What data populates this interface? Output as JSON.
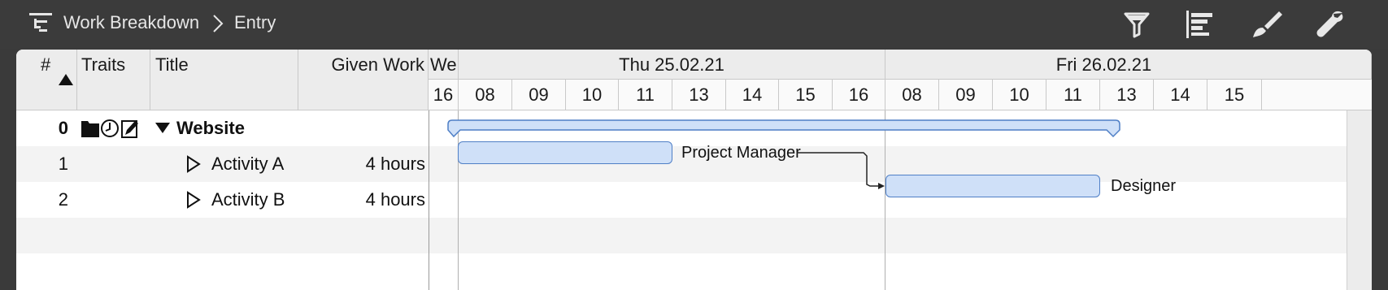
{
  "toolbar": {
    "breadcrumb_root": "Work Breakdown",
    "breadcrumb_current": "Entry",
    "icons": [
      "filter-icon",
      "gantt-icon",
      "brush-icon",
      "wrench-icon"
    ]
  },
  "table": {
    "headers": {
      "number": "#",
      "traits": "Traits",
      "title": "Title",
      "given_work": "Given Work"
    },
    "rows": [
      {
        "number": "0",
        "title": "Website",
        "given_work": "",
        "expanded": true,
        "is_summary": true
      },
      {
        "number": "1",
        "title": "Activity A",
        "given_work": "4 hours",
        "expanded": false,
        "is_summary": false
      },
      {
        "number": "2",
        "title": "Activity B",
        "given_work": "4 hours",
        "expanded": false,
        "is_summary": false
      }
    ]
  },
  "timeline": {
    "days": [
      "We",
      "Thu 25.02.21",
      "Fri 26.02.21"
    ],
    "hours_prev": [
      "16"
    ],
    "hours_thu": [
      "08",
      "09",
      "10",
      "11",
      "13",
      "14",
      "15",
      "16"
    ],
    "hours_fri": [
      "08",
      "09",
      "10",
      "11",
      "13",
      "14",
      "15"
    ]
  },
  "gantt": {
    "resource_a": "Project Manager",
    "resource_b": "Designer",
    "colors": {
      "bar_fill": "#cfe0f8",
      "bar_border": "#4f7fc6"
    }
  }
}
